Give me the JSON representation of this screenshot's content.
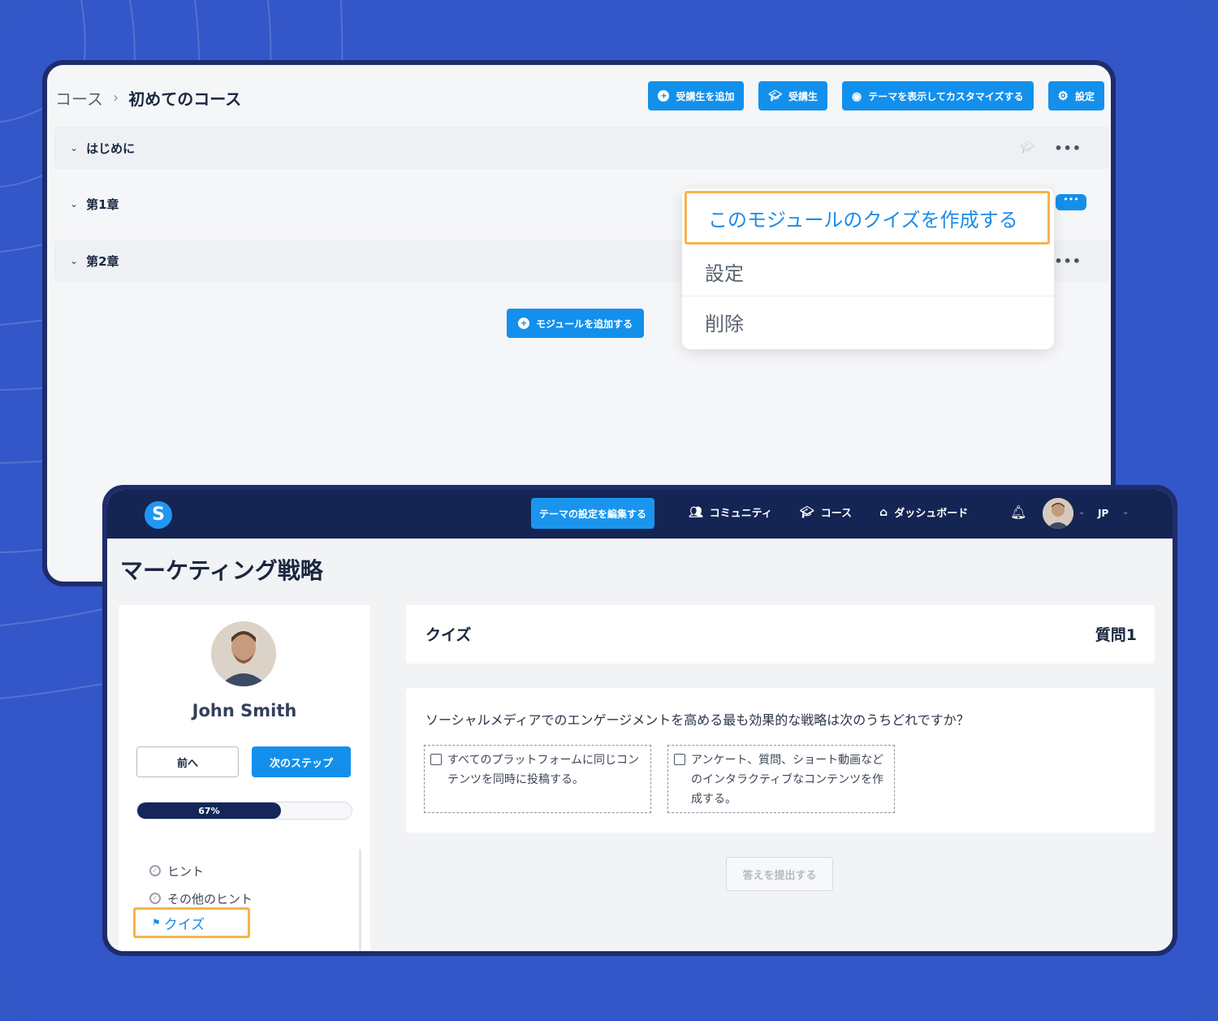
{
  "course_editor": {
    "breadcrumb": {
      "root": "コース",
      "separator": "›",
      "current": "初めてのコース"
    },
    "toolbar": {
      "add_student": "受講生を追加",
      "students": "受講生",
      "customize_theme": "テーマを表示してカスタマイズする",
      "settings": "設定"
    },
    "modules": [
      {
        "label": "はじめに"
      },
      {
        "label": "第1章"
      },
      {
        "label": "第2章"
      }
    ],
    "more_label": "•••",
    "add_module": "モジュールを追加する",
    "context_menu": {
      "items": [
        "このモジュールのクイズを作成する",
        "設定",
        "削除"
      ]
    }
  },
  "student_view": {
    "nav": {
      "logo": "S",
      "edit_theme": "テーマの設定を編集する",
      "links": [
        "コミュニティ",
        "コース",
        "ダッシュボード"
      ],
      "language": "JP"
    },
    "page_title": "マーケティング戦略",
    "sidebar": {
      "user_name": "John Smith",
      "prev": "前へ",
      "next": "次のステップ",
      "progress_label": "67%",
      "progress_value": 0.67,
      "lessons": [
        "ヒント",
        "その他のヒント"
      ],
      "active_lesson": "クイズ"
    },
    "quiz": {
      "title": "クイズ",
      "question_number": "質問1",
      "question": "ソーシャルメディアでのエンゲージメントを高める最も効果的な戦略は次のうちどれですか？",
      "options": [
        "すべてのプラットフォームに同じコンテンツを同時に投稿する。",
        "アンケート、質問、ショート動画などのインタラクティブなコンテンツを作成する。"
      ],
      "submit": "答えを提出する"
    }
  },
  "colors": {
    "background": "#3356c8",
    "primary": "#1390ec",
    "nav": "#142554",
    "highlight": "#f4b548"
  }
}
